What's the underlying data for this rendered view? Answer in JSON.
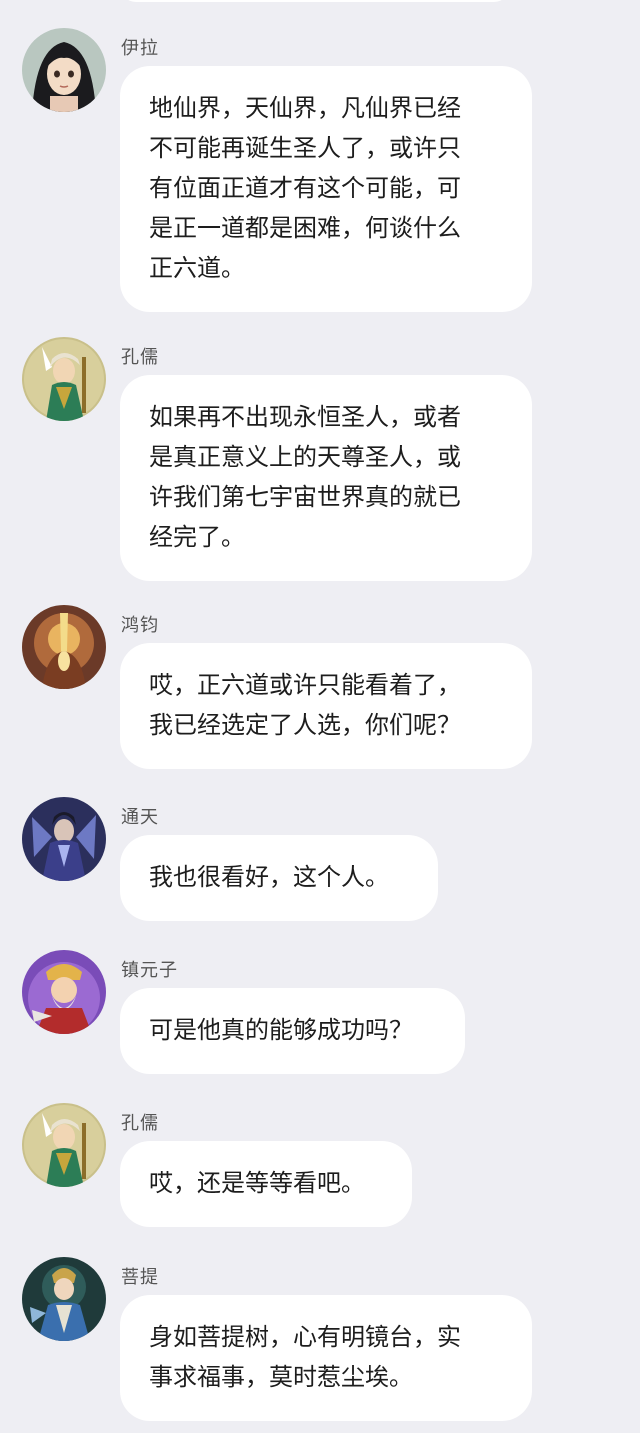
{
  "colors": {
    "background": "#eeeef3",
    "bubble": "#ffffff",
    "sender_name": "#555555",
    "message_text": "#1d1d1d"
  },
  "messages": [
    {
      "sender": "伊拉",
      "avatar_icon": "anime-girl-avatar-icon",
      "lines": [
        "地仙界，天仙界，凡仙界已经",
        "不可能再诞生圣人了，或许只",
        "有位面正道才有这个可能，可",
        "是正一道都是困难，何谈什么",
        "正六道。"
      ]
    },
    {
      "sender": "孔儒",
      "avatar_icon": "sage-warrior-avatar-icon",
      "lines": [
        "如果再不出现永恒圣人，或者",
        "是真正意义上的天尊圣人，或",
        "许我们第七宇宙世界真的就已",
        "经完了。"
      ]
    },
    {
      "sender": "鸿钧",
      "avatar_icon": "golden-immortal-avatar-icon",
      "lines": [
        "哎，正六道或许只能看着了，",
        "我已经选定了人选，你们呢？"
      ]
    },
    {
      "sender": "通天",
      "avatar_icon": "dark-sage-avatar-icon",
      "lines": [
        "我也很看好，这个人。"
      ]
    },
    {
      "sender": "镇元子",
      "avatar_icon": "bearded-elder-avatar-icon",
      "lines": [
        "可是他真的能够成功吗？"
      ]
    },
    {
      "sender": "孔儒",
      "avatar_icon": "sage-warrior-avatar-icon",
      "lines": [
        "哎，还是等等看吧。"
      ]
    },
    {
      "sender": "菩提",
      "avatar_icon": "blue-robed-master-avatar-icon",
      "lines": [
        "身如菩提树，心有明镜台，实",
        "事求福事，莫时惹尘埃。"
      ]
    }
  ]
}
